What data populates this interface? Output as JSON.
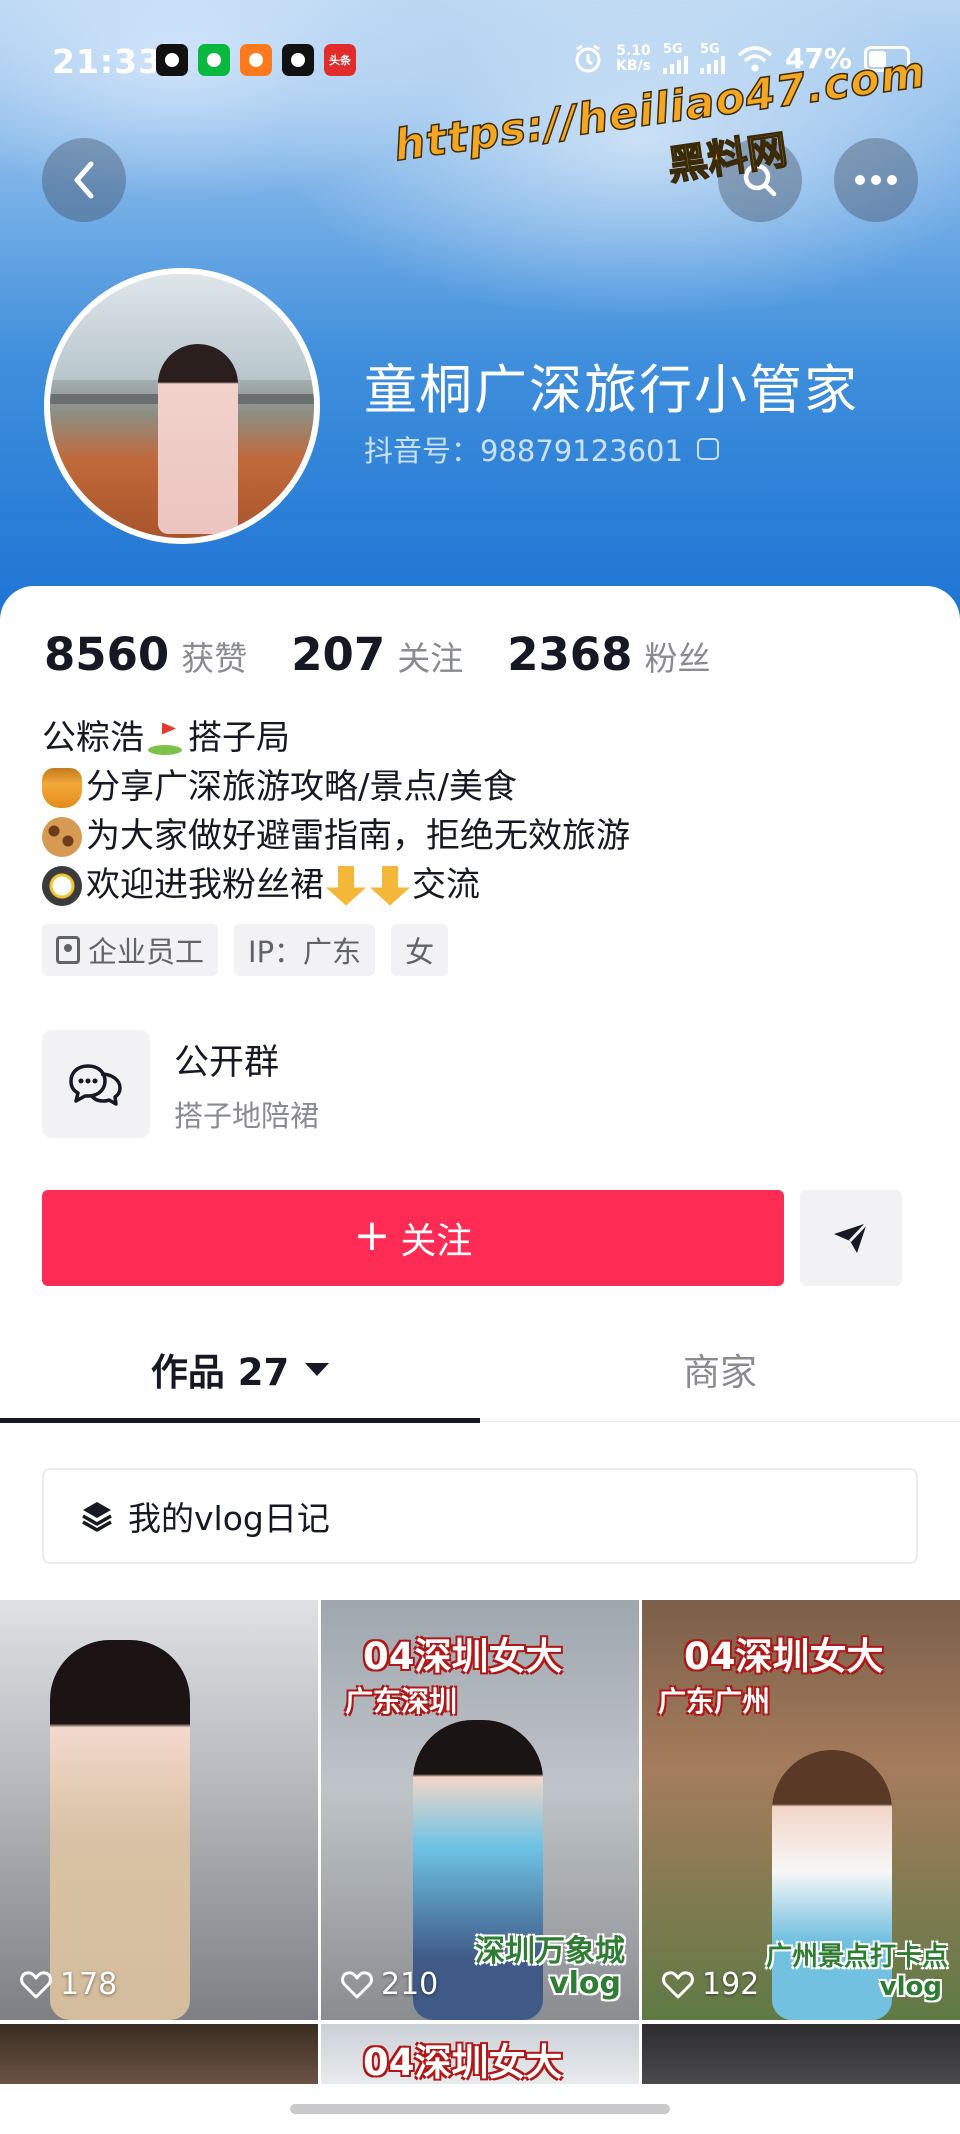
{
  "status_bar": {
    "time": "21:33",
    "net_speed_value": "5.10",
    "net_speed_unit": "KB/s",
    "signal_1": "5G",
    "signal_2": "5G",
    "battery": "47%"
  },
  "watermark": {
    "url": "https://heiliao47.com",
    "name": "黑料网"
  },
  "profile": {
    "nickname": "童桐广深旅行小管家",
    "douyin_id": "抖音号：98879123601"
  },
  "stats": [
    {
      "value": "8560",
      "label": "获赞"
    },
    {
      "value": "207",
      "label": "关注"
    },
    {
      "value": "2368",
      "label": "粉丝"
    }
  ],
  "bio": {
    "line1": "公粽浩",
    "line1_tail": "搭子局",
    "line2": "分享广深旅游攻略/景点/美食",
    "line3": "为大家做好避雷指南，拒绝无效旅游",
    "line4": "欢迎进我粉丝裙",
    "line4_tail": "交流"
  },
  "tags": [
    {
      "label": "企业员工",
      "icon": "badge-icon"
    },
    {
      "label": "IP：广东"
    },
    {
      "label": "女"
    }
  ],
  "group": {
    "title": "公开群",
    "subtitle": "搭子地陪裙"
  },
  "actions": {
    "follow_label": "关注",
    "follow_color": "#fe2c55"
  },
  "tabs": {
    "works_label": "作品 27",
    "shop_label": "商家"
  },
  "collection": {
    "label": "我的vlog日记"
  },
  "videos": [
    {
      "likes": "178"
    },
    {
      "likes": "210",
      "title": "04深圳女大",
      "location": "广东深圳",
      "caption_1": "深圳万象城",
      "caption_2": "vlog"
    },
    {
      "likes": "192",
      "title": "04深圳女大",
      "location": "广东广州",
      "caption_1": "广州景点打卡点",
      "caption_2": "vlog"
    },
    {},
    {
      "title": "04深圳女大"
    },
    {}
  ]
}
